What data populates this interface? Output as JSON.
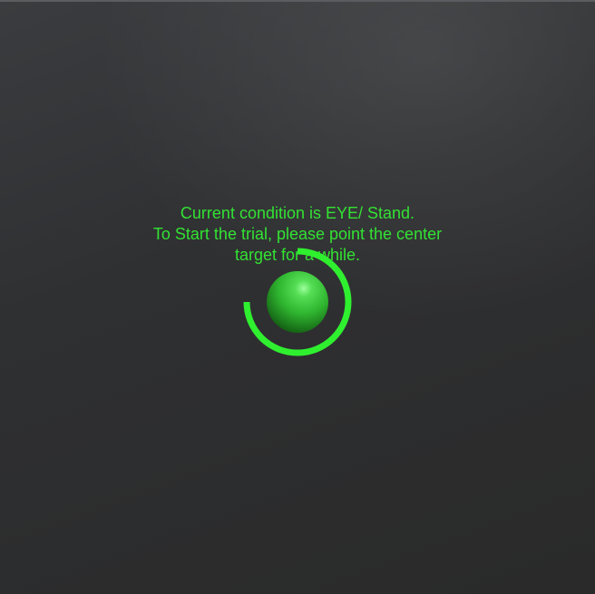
{
  "instructions": {
    "line1": "Current condition is EYE/ Stand.",
    "line2": "To Start the trial, please point the center",
    "line3": "target for a while."
  },
  "target": {
    "icon": "sphere-target",
    "sphere_color": "#2fb52f",
    "ring_color": "#2ff02f",
    "dwell_progress": 0.75
  },
  "colors": {
    "text": "#33e233",
    "background": "#2e2f31"
  }
}
